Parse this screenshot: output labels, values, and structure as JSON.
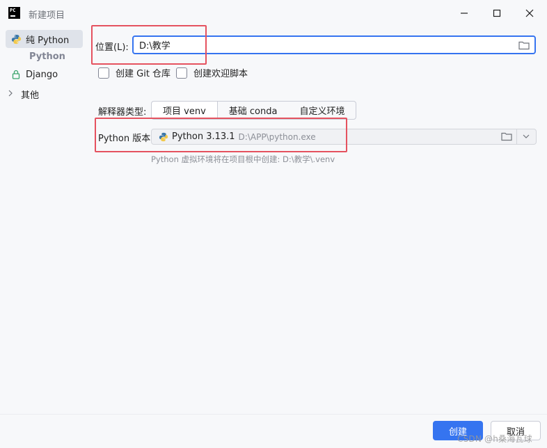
{
  "window": {
    "title": "新建项目",
    "logo_text": "PC",
    "icons": {
      "minimize": "minimize-icon",
      "maximize": "maximize-icon",
      "close": "close-icon"
    }
  },
  "sidebar": {
    "items": [
      {
        "label": "纯 Python",
        "icon": "python-icon",
        "selected": true
      },
      {
        "label": "Django",
        "icon": "django-icon",
        "selected": false
      }
    ],
    "group_label": "Python",
    "other_label": "其他"
  },
  "main": {
    "location_label": "位置(L):",
    "location_value": "D:\\教学",
    "create_git_label": "创建 Git 仓库",
    "create_welcome_label": "创建欢迎脚本",
    "interpreter_type_label": "解释器类型:",
    "tabs": [
      {
        "label": "项目 venv",
        "active": true
      },
      {
        "label": "基础 conda",
        "active": false
      },
      {
        "label": "自定义环境",
        "active": false
      }
    ],
    "python_version_label": "Python 版本:",
    "python_version": "Python 3.13.1",
    "python_path": "D:\\APP\\python.exe",
    "hint": "Python 虚拟环境将在项目根中创建: D:\\教学\\.venv"
  },
  "footer": {
    "create_label": "创建",
    "cancel_label": "取消",
    "watermark": "CSDN @h桑海瓦球"
  },
  "colors": {
    "accent": "#3574f0",
    "annotation": "#e5525f",
    "background": "#f7f8fa"
  }
}
